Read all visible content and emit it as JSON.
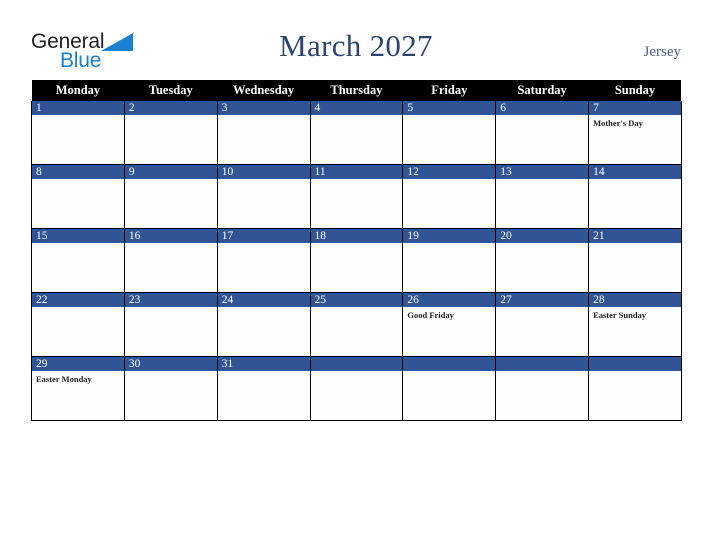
{
  "brand": {
    "name_part1": "General",
    "name_part2": "Blue",
    "triangle_icon": "blue-triangle-icon",
    "blue": "#1b7fd4",
    "dark": "#231f20"
  },
  "header": {
    "title": "March 2027",
    "region": "Jersey",
    "title_color": "#2d4470",
    "region_color": "#4a5f8c"
  },
  "calendar": {
    "accent_color": "#2f5597",
    "header_bg": "#000000",
    "header_fg": "#ffffff",
    "weekday_headers": [
      "Monday",
      "Tuesday",
      "Wednesday",
      "Thursday",
      "Friday",
      "Saturday",
      "Sunday"
    ],
    "weeks": [
      [
        {
          "day": "1",
          "event": ""
        },
        {
          "day": "2",
          "event": ""
        },
        {
          "day": "3",
          "event": ""
        },
        {
          "day": "4",
          "event": ""
        },
        {
          "day": "5",
          "event": ""
        },
        {
          "day": "6",
          "event": ""
        },
        {
          "day": "7",
          "event": "Mother's Day"
        }
      ],
      [
        {
          "day": "8",
          "event": ""
        },
        {
          "day": "9",
          "event": ""
        },
        {
          "day": "10",
          "event": ""
        },
        {
          "day": "11",
          "event": ""
        },
        {
          "day": "12",
          "event": ""
        },
        {
          "day": "13",
          "event": ""
        },
        {
          "day": "14",
          "event": ""
        }
      ],
      [
        {
          "day": "15",
          "event": ""
        },
        {
          "day": "16",
          "event": ""
        },
        {
          "day": "17",
          "event": ""
        },
        {
          "day": "18",
          "event": ""
        },
        {
          "day": "19",
          "event": ""
        },
        {
          "day": "20",
          "event": ""
        },
        {
          "day": "21",
          "event": ""
        }
      ],
      [
        {
          "day": "22",
          "event": ""
        },
        {
          "day": "23",
          "event": ""
        },
        {
          "day": "24",
          "event": ""
        },
        {
          "day": "25",
          "event": ""
        },
        {
          "day": "26",
          "event": "Good Friday"
        },
        {
          "day": "27",
          "event": ""
        },
        {
          "day": "28",
          "event": "Easter Sunday"
        }
      ],
      [
        {
          "day": "29",
          "event": "Easter Monday"
        },
        {
          "day": "30",
          "event": ""
        },
        {
          "day": "31",
          "event": ""
        },
        {
          "day": "",
          "event": ""
        },
        {
          "day": "",
          "event": ""
        },
        {
          "day": "",
          "event": ""
        },
        {
          "day": "",
          "event": ""
        }
      ]
    ]
  }
}
